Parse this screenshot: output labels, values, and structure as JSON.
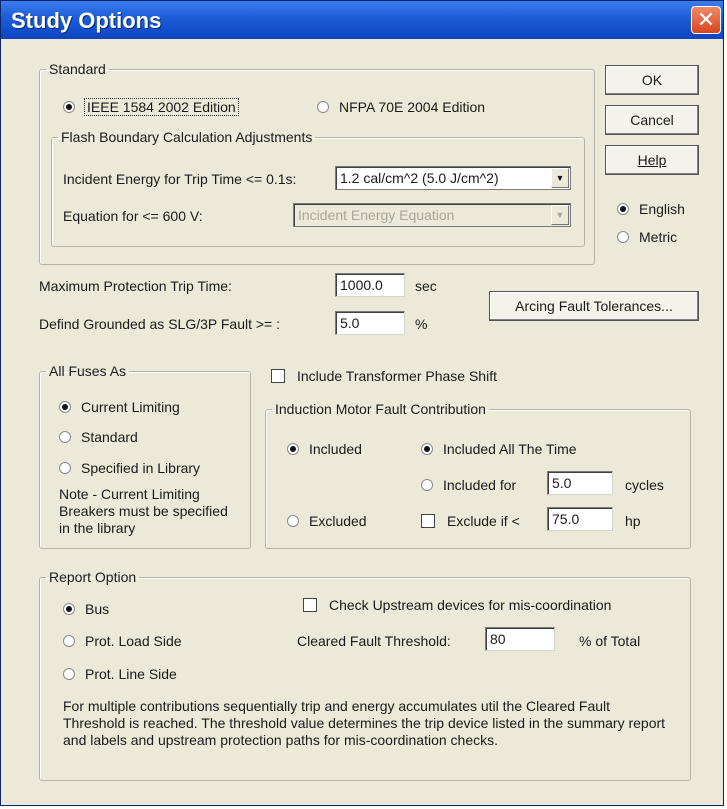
{
  "window": {
    "title": "Study Options"
  },
  "buttons": {
    "ok": "OK",
    "cancel": "Cancel",
    "help": "Help",
    "arcing": "Arcing Fault Tolerances..."
  },
  "units": {
    "english": "English",
    "metric": "Metric",
    "selected": "English"
  },
  "standard": {
    "legend": "Standard",
    "options": [
      "IEEE 1584 2002 Edition",
      "NFPA 70E 2004 Edition"
    ],
    "selected": "IEEE 1584 2002 Edition",
    "flash": {
      "legend": "Flash Boundary Calculation Adjustments",
      "incident_label": "Incident Energy for Trip Time <= 0.1s:",
      "incident_value": "1.2 cal/cm^2 (5.0 J/cm^2)",
      "equation_label": "Equation for <= 600 V:",
      "equation_value": "Incident Energy Equation"
    }
  },
  "protection": {
    "trip_label": "Maximum Protection Trip Time:",
    "trip_value": "1000.0",
    "trip_unit": "sec",
    "grounded_label": "Defind Grounded as SLG/3P Fault >= :",
    "grounded_value": "5.0",
    "grounded_unit": "%"
  },
  "fuses": {
    "legend": "All Fuses As",
    "options": [
      "Current Limiting",
      "Standard",
      "Specified in Library"
    ],
    "selected": "Current Limiting",
    "note": "Note - Current Limiting Breakers must be specified in the library"
  },
  "transformer_phase_shift": {
    "label": "Include Transformer Phase Shift",
    "checked": false
  },
  "induction": {
    "legend": "Induction Motor Fault Contribution",
    "included": "Included",
    "excluded": "Excluded",
    "selected": "Included",
    "all_time": "Included All The Time",
    "included_for": "Included for",
    "included_for_value": "5.0",
    "cycles": "cycles",
    "exclude_if": "Exclude if <",
    "exclude_value": "75.0",
    "hp": "hp",
    "sub_selected": "Included All The Time"
  },
  "report": {
    "legend": "Report Option",
    "options": [
      "Bus",
      "Prot. Load Side",
      "Prot. Line Side"
    ],
    "selected": "Bus",
    "check_upstream": "Check Upstream devices for mis-coordination",
    "threshold_label": "Cleared Fault Threshold:",
    "threshold_value": "80",
    "threshold_unit": "% of Total",
    "note": "For multiple contributions sequentially trip and energy accumulates util the Cleared Fault Threshold is reached.  The threshold value determines the trip device listed in the summary report and labels and upstream protection paths for mis-coordination checks."
  }
}
